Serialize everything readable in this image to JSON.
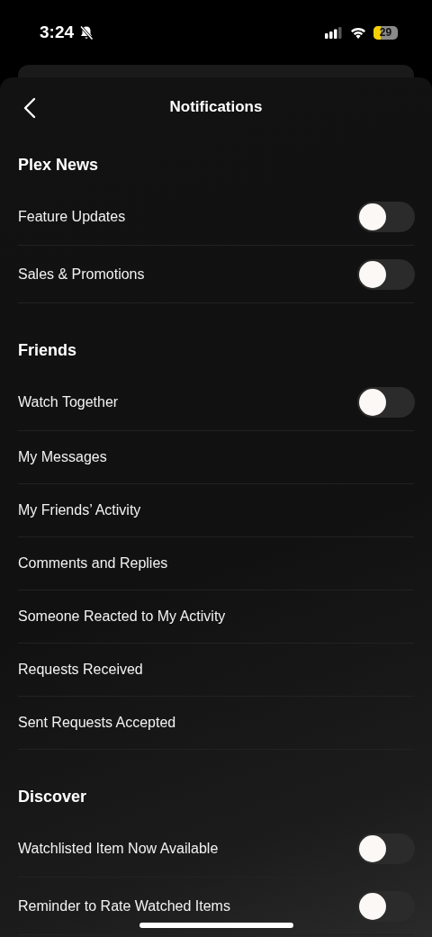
{
  "status_bar": {
    "time": "3:24",
    "battery": "29"
  },
  "header": {
    "title": "Notifications"
  },
  "sections": [
    {
      "title": "Plex News",
      "items": [
        {
          "label": "Feature Updates",
          "kind": "toggle",
          "on": false
        },
        {
          "label": "Sales & Promotions",
          "kind": "toggle",
          "on": false
        }
      ]
    },
    {
      "title": "Friends",
      "items": [
        {
          "label": "Watch Together",
          "kind": "toggle",
          "on": false
        },
        {
          "label": "My Messages",
          "kind": "link"
        },
        {
          "label": "My Friends’ Activity",
          "kind": "link"
        },
        {
          "label": "Comments and Replies",
          "kind": "link"
        },
        {
          "label": "Someone Reacted to My Activity",
          "kind": "link"
        },
        {
          "label": "Requests Received",
          "kind": "link"
        },
        {
          "label": "Sent Requests Accepted",
          "kind": "link"
        }
      ]
    },
    {
      "title": "Discover",
      "items": [
        {
          "label": "Watchlisted Item Now Available",
          "kind": "toggle",
          "on": false
        },
        {
          "label": "Reminder to Rate Watched Items",
          "kind": "toggle",
          "on": false
        }
      ]
    }
  ]
}
